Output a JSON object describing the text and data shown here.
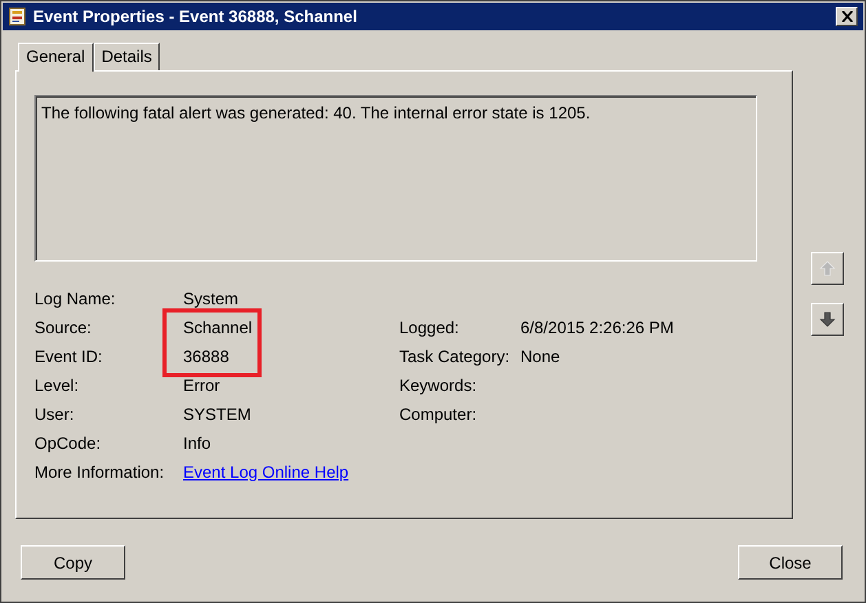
{
  "window": {
    "title": "Event Properties - Event 36888, Schannel"
  },
  "tabs": [
    {
      "label": "General",
      "selected": true
    },
    {
      "label": "Details",
      "selected": false
    }
  ],
  "message": "The following fatal alert was generated: 40. The internal error state is 1205.",
  "fields_left": [
    {
      "label": "Log Name:",
      "value": "System",
      "kind": "text",
      "highlighted": false
    },
    {
      "label": "Source:",
      "value": "Schannel",
      "kind": "text",
      "highlighted": true
    },
    {
      "label": "Event ID:",
      "value": "36888",
      "kind": "text",
      "highlighted": true
    },
    {
      "label": "Level:",
      "value": "Error",
      "kind": "text",
      "highlighted": false
    },
    {
      "label": "User:",
      "value": "SYSTEM",
      "kind": "text",
      "highlighted": false
    },
    {
      "label": "OpCode:",
      "value": "Info",
      "kind": "text",
      "highlighted": false
    },
    {
      "label": "More Information:",
      "value": "Event Log Online Help",
      "kind": "link",
      "highlighted": false
    }
  ],
  "fields_right": [
    {
      "label": "Logged:",
      "value": "6/8/2015 2:26:26 PM"
    },
    {
      "label": "Task Category:",
      "value": "None"
    },
    {
      "label": "Keywords:"
    },
    {
      "label": "Computer:"
    }
  ],
  "nav_buttons": [
    {
      "kind": "up",
      "disabled": true
    },
    {
      "kind": "down",
      "disabled": false
    }
  ],
  "buttons": [
    {
      "label": "Copy"
    },
    {
      "label": "Close"
    }
  ]
}
